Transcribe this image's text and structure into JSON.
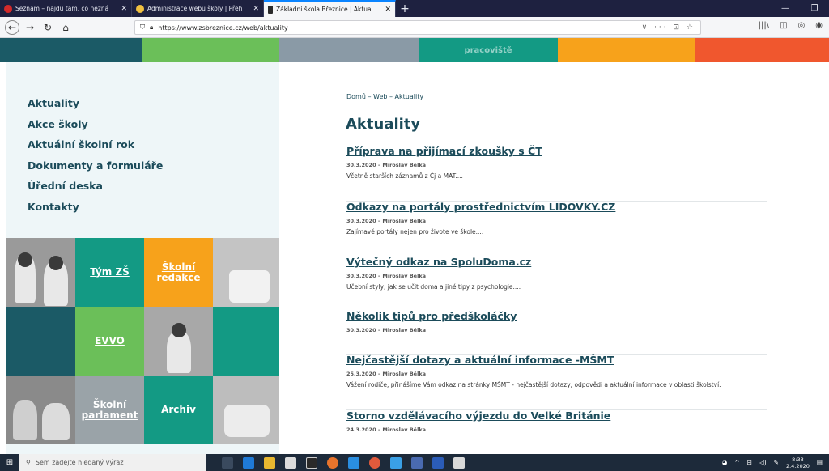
{
  "browser": {
    "tabs": [
      {
        "title": "Seznam – najdu tam, co nezná",
        "favicon_color": "#d42a2a",
        "active": false
      },
      {
        "title": "Administrace webu školy | Přeh",
        "favicon_color": "#f0c040",
        "active": false
      },
      {
        "title": "Základní škola Březnice | Aktua",
        "favicon_color": "#2a2a2a",
        "active": true
      }
    ],
    "new_tab": "+",
    "url": "https://www.zsbreznice.cz/web/aktuality",
    "url_right_icons": "∨ ··· ⊡ ☆"
  },
  "banner": {
    "labels": [
      "",
      "",
      "",
      "pracoviště",
      "",
      ""
    ]
  },
  "sidebar": {
    "nav": [
      {
        "label": "Aktuality",
        "current": true
      },
      {
        "label": "Akce školy",
        "current": false
      },
      {
        "label": "Aktuální školní rok",
        "current": false
      },
      {
        "label": "Dokumenty a formuláře",
        "current": false
      },
      {
        "label": "Úřední deska",
        "current": false
      },
      {
        "label": "Kontakty",
        "current": false
      }
    ],
    "tiles": {
      "tym": "Tým ZŠ",
      "redakce": "Školní redakce",
      "evvo": "EVVO",
      "parlament": "Školní parlament",
      "archiv": "Archiv"
    },
    "tile_colors": {
      "teal": "#139a84",
      "orange": "#f7a21b",
      "green": "#6bbf59",
      "dark_teal": "#1b5a66",
      "grey": "#9aa3a8"
    }
  },
  "content": {
    "breadcrumb": "Domů – Web – Aktuality",
    "title": "Aktuality",
    "articles": [
      {
        "title": "Příprava na přijímací zkoušky s ČT",
        "meta": "30.3.2020 – Miroslav Bělka",
        "excerpt": "Včetně starších záznamů z Čj a MAT...."
      },
      {
        "title": "Odkazy na portály prostřednictvím LIDOVKY.CZ",
        "meta": "30.3.2020 – Miroslav Bělka",
        "excerpt": "Zajímavé portály nejen pro živote ve škole...."
      },
      {
        "title": "Výtečný odkaz na SpoluDoma.cz",
        "meta": "30.3.2020 – Miroslav Bělka",
        "excerpt": "Učební styly, jak se učit doma a jiné tipy z psychologie...."
      },
      {
        "title": "Několik tipů pro předškoláčky",
        "meta": "30.3.2020 – Miroslav Bělka",
        "excerpt": ""
      },
      {
        "title": "Nejčastější dotazy a aktuální informace -MŠMT",
        "meta": "25.3.2020 – Miroslav Bělka",
        "excerpt": "Vážení rodiče, přinášíme Vám odkaz na stránky MŠMT - nejčastější dotazy, odpovědi a aktuální informace v oblasti školství."
      },
      {
        "title": "Storno vzdělávacího výjezdu do Velké Británie",
        "meta": "24.3.2020 – Miroslav Bělka",
        "excerpt": ""
      }
    ],
    "heading_color": "#1b4b5a"
  },
  "taskbar": {
    "search_placeholder": "Sem zadejte hledaný výraz",
    "time": "8:33",
    "date": "2.4.2020"
  }
}
